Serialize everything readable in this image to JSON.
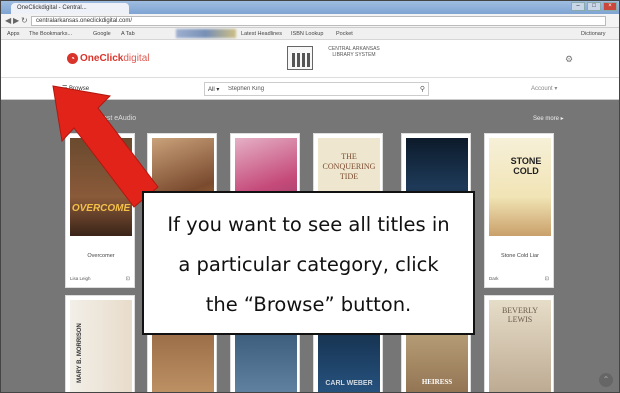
{
  "browser": {
    "tab_title": "OneClickdigital - Central...",
    "url": "centralarkansas.oneclickdigital.com/",
    "bookmarks": [
      "Apps",
      "The Bookmarks...",
      "Google",
      "A Tab",
      "Latest Headlines",
      "ISBN Lookup",
      "Pocket",
      "Dictionary"
    ]
  },
  "site": {
    "logo_text": "OneClick",
    "logo_suffix": "digital",
    "library_name": "CENTRAL ARKANSAS LIBRARY SYSTEM",
    "browse_label": "Browse",
    "search_type": "All ▾",
    "search_value": "Stephen King",
    "account_label": "Account ▾"
  },
  "section": {
    "title": "Newest eAudio",
    "see_more": "See more ▸"
  },
  "books_row1": [
    {
      "title": "Overcomer",
      "cover_text": "OVERCOME",
      "foot_left": "Lisa Leigh",
      "foot_right": "⊡"
    },
    {
      "title": "",
      "cover_text": "",
      "foot_left": "",
      "foot_right": ""
    },
    {
      "title": "",
      "cover_text": "",
      "foot_left": "",
      "foot_right": ""
    },
    {
      "title": "",
      "cover_text": "THE CONQUERING TIDE",
      "foot_left": "",
      "foot_right": ""
    },
    {
      "title": "",
      "cover_text": "",
      "foot_left": "",
      "foot_right": ""
    },
    {
      "title": "Stone Cold Liar",
      "cover_text": "STONE COLD",
      "foot_left": "Dark",
      "foot_right": "⊡"
    }
  ],
  "books_row2": [
    {
      "cover_text": "MARY B. MORRISON"
    },
    {
      "cover_text": ""
    },
    {
      "cover_text": ""
    },
    {
      "cover_text": "CARL WEBER"
    },
    {
      "cover_text": "HEIRESS"
    },
    {
      "cover_text": "BEVERLY LEWIS"
    }
  ],
  "callout": {
    "line1": "If you want to see all titles in",
    "line2": "a particular category, click",
    "line3": "the “Browse” button."
  },
  "colors": {
    "brand": "#d9342b",
    "arrow": "#e2231a",
    "content_bg": "#767676"
  }
}
